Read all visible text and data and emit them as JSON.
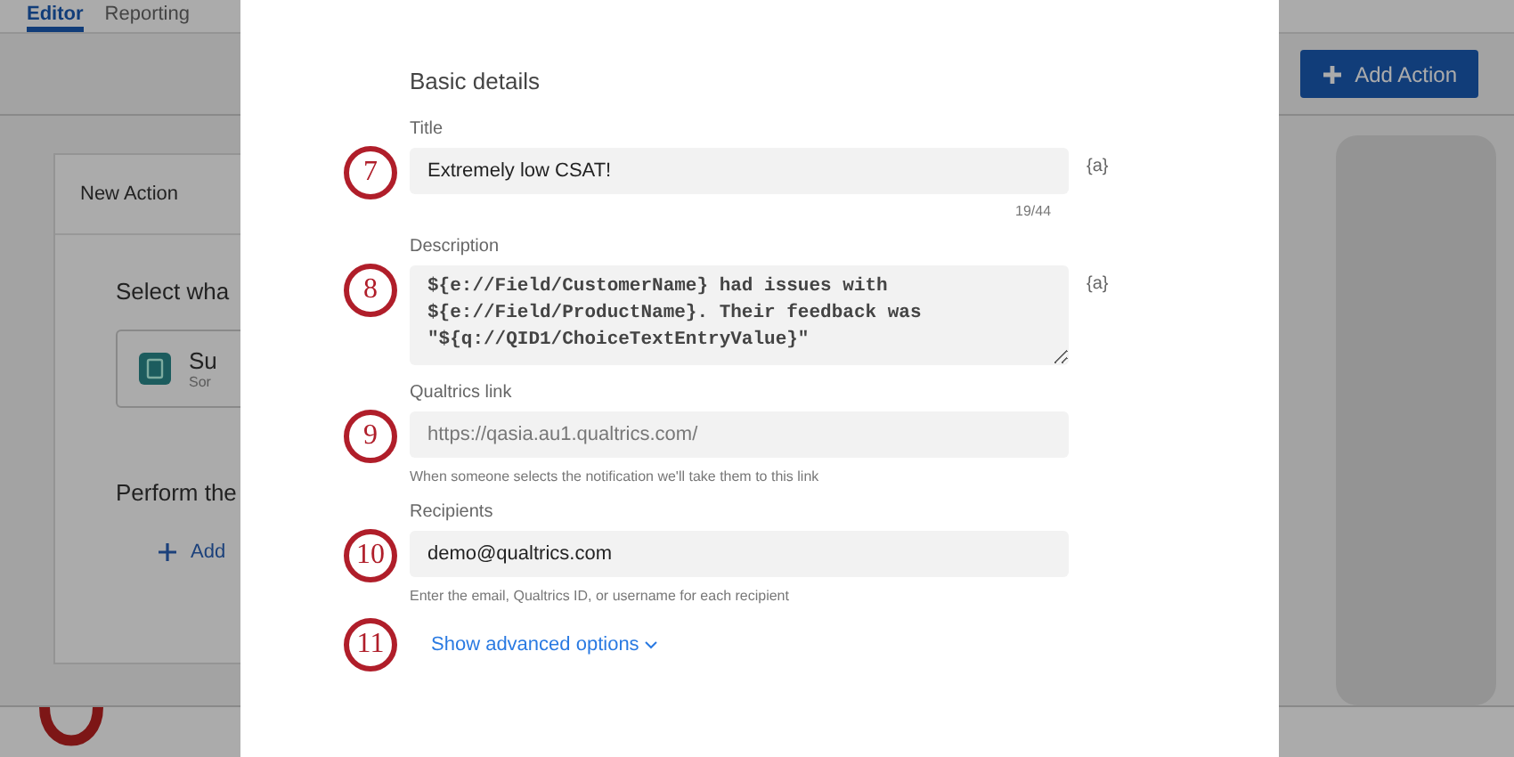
{
  "tabs": [
    {
      "label": "Editor",
      "selected": true
    },
    {
      "label": "Reporting",
      "selected": false
    }
  ],
  "toolbar": {
    "add_button": "Add Action"
  },
  "action_card": {
    "title": "New Action",
    "prompt": "Select wha",
    "event_title": "Su",
    "event_subtitle": "Sor",
    "task_prompt": "Perform the",
    "add_link": "Add"
  },
  "modal": {
    "section_title": "Basic details",
    "fields": [
      {
        "step": "7",
        "label": "Title",
        "kind": "input",
        "value": "Extremely low CSAT!",
        "counter": "19/44",
        "piped_text": "{a}"
      },
      {
        "step": "8",
        "label": "Description",
        "kind": "textarea",
        "value": "${e://Field/CustomerName} had issues with\n${e://Field/ProductName}. Their feedback was\n\"${q://QID1/ChoiceTextEntryValue}\"",
        "piped_text": "{a}"
      },
      {
        "step": "9",
        "label": "Qualtrics link",
        "kind": "input",
        "placeholder": "https://qasia.au1.qualtrics.com/",
        "help": "When someone selects the notification we'll take them to this link"
      },
      {
        "step": "10",
        "label": "Recipients",
        "kind": "input",
        "value": "demo@qualtrics.com",
        "help": "Enter the email, Qualtrics ID, or username for each recipient"
      }
    ],
    "advanced": {
      "step": "11",
      "label": "Show advanced options",
      "expanded": false
    }
  }
}
